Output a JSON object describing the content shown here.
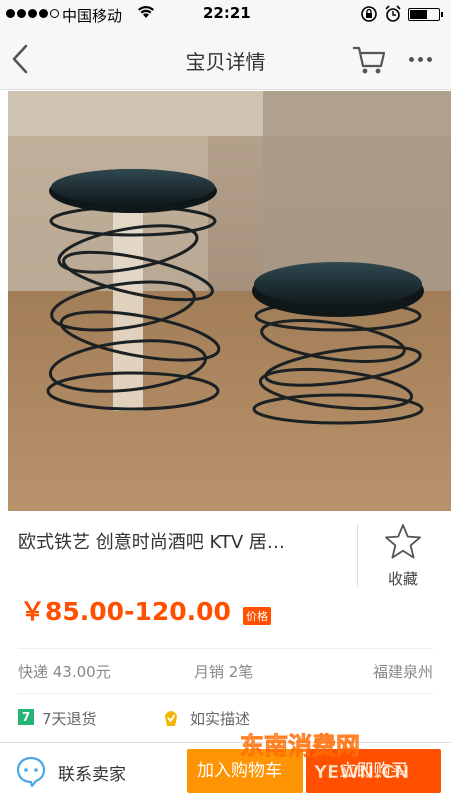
{
  "status_bar": {
    "carrier": "中国移动",
    "time": "22:21"
  },
  "nav": {
    "title": "宝贝详情",
    "icons": {
      "back": "back-arrow-icon",
      "cart": "cart-icon",
      "more": "more-icon"
    }
  },
  "product": {
    "title": "欧式铁艺 创意时尚酒吧 KTV 居…",
    "favorite_label": "收藏",
    "price": "￥85.00-120.00",
    "price_tag": "价格",
    "image_count": 1,
    "current_image": 1
  },
  "info": {
    "shipping": "快递 43.00元",
    "monthly_sales": "月销 2笔",
    "location": "福建泉州"
  },
  "services": {
    "return_badge": "7",
    "return_label": "7天退货",
    "honest_label": "如实描述"
  },
  "bottom_bar": {
    "contact_label": "联系卖家",
    "add_to_cart_label": "加入购物车",
    "buy_now_label": "立即购买"
  },
  "watermark": {
    "text_top": "东南消费网",
    "text_bottom": "YEWN.CN"
  },
  "colors": {
    "accent": "#ff5000",
    "cart_button": "#ff9402",
    "return_badge": "#22b573"
  }
}
